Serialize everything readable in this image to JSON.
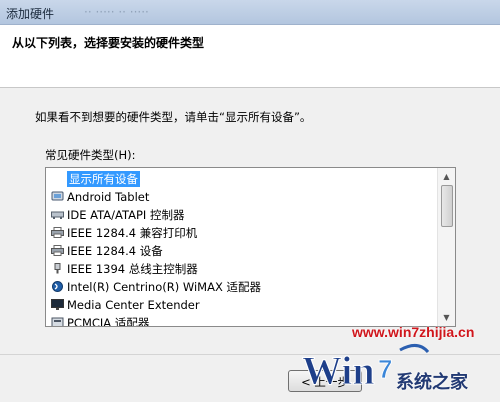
{
  "window": {
    "title": "添加硬件",
    "ghost_text": "·· ····· ·· ·····"
  },
  "header": {
    "heading": "从以下列表，选择要安装的硬件类型"
  },
  "content": {
    "hint": "如果看不到想要的硬件类型，请单击“显示所有设备”。",
    "list_label": "常见硬件类型(H):",
    "items": [
      {
        "label": "显示所有设备",
        "icon": "none",
        "selected": true
      },
      {
        "label": "Android Tablet",
        "icon": "tablet-icon"
      },
      {
        "label": "IDE ATA/ATAPI 控制器",
        "icon": "ide-controller-icon"
      },
      {
        "label": "IEEE 1284.4 兼容打印机",
        "icon": "printer-icon"
      },
      {
        "label": "IEEE 1284.4 设备",
        "icon": "printer-icon"
      },
      {
        "label": "IEEE 1394 总线主控制器",
        "icon": "firewire-icon"
      },
      {
        "label": "Intel(R) Centrino(R) WiMAX 适配器",
        "icon": "wimax-icon"
      },
      {
        "label": "Media Center Extender",
        "icon": "monitor-icon"
      },
      {
        "label": "PCMCIA 适配器",
        "icon": "pcmcia-icon"
      }
    ]
  },
  "footer": {
    "back_label": "< 上一步"
  },
  "watermark": {
    "url": "www.win7zhijia.cn",
    "logo_text": "系统之家"
  },
  "colors": {
    "selection": "#3399ff",
    "watermark_red": "#d0161c",
    "watermark_blue": "#223a74"
  }
}
